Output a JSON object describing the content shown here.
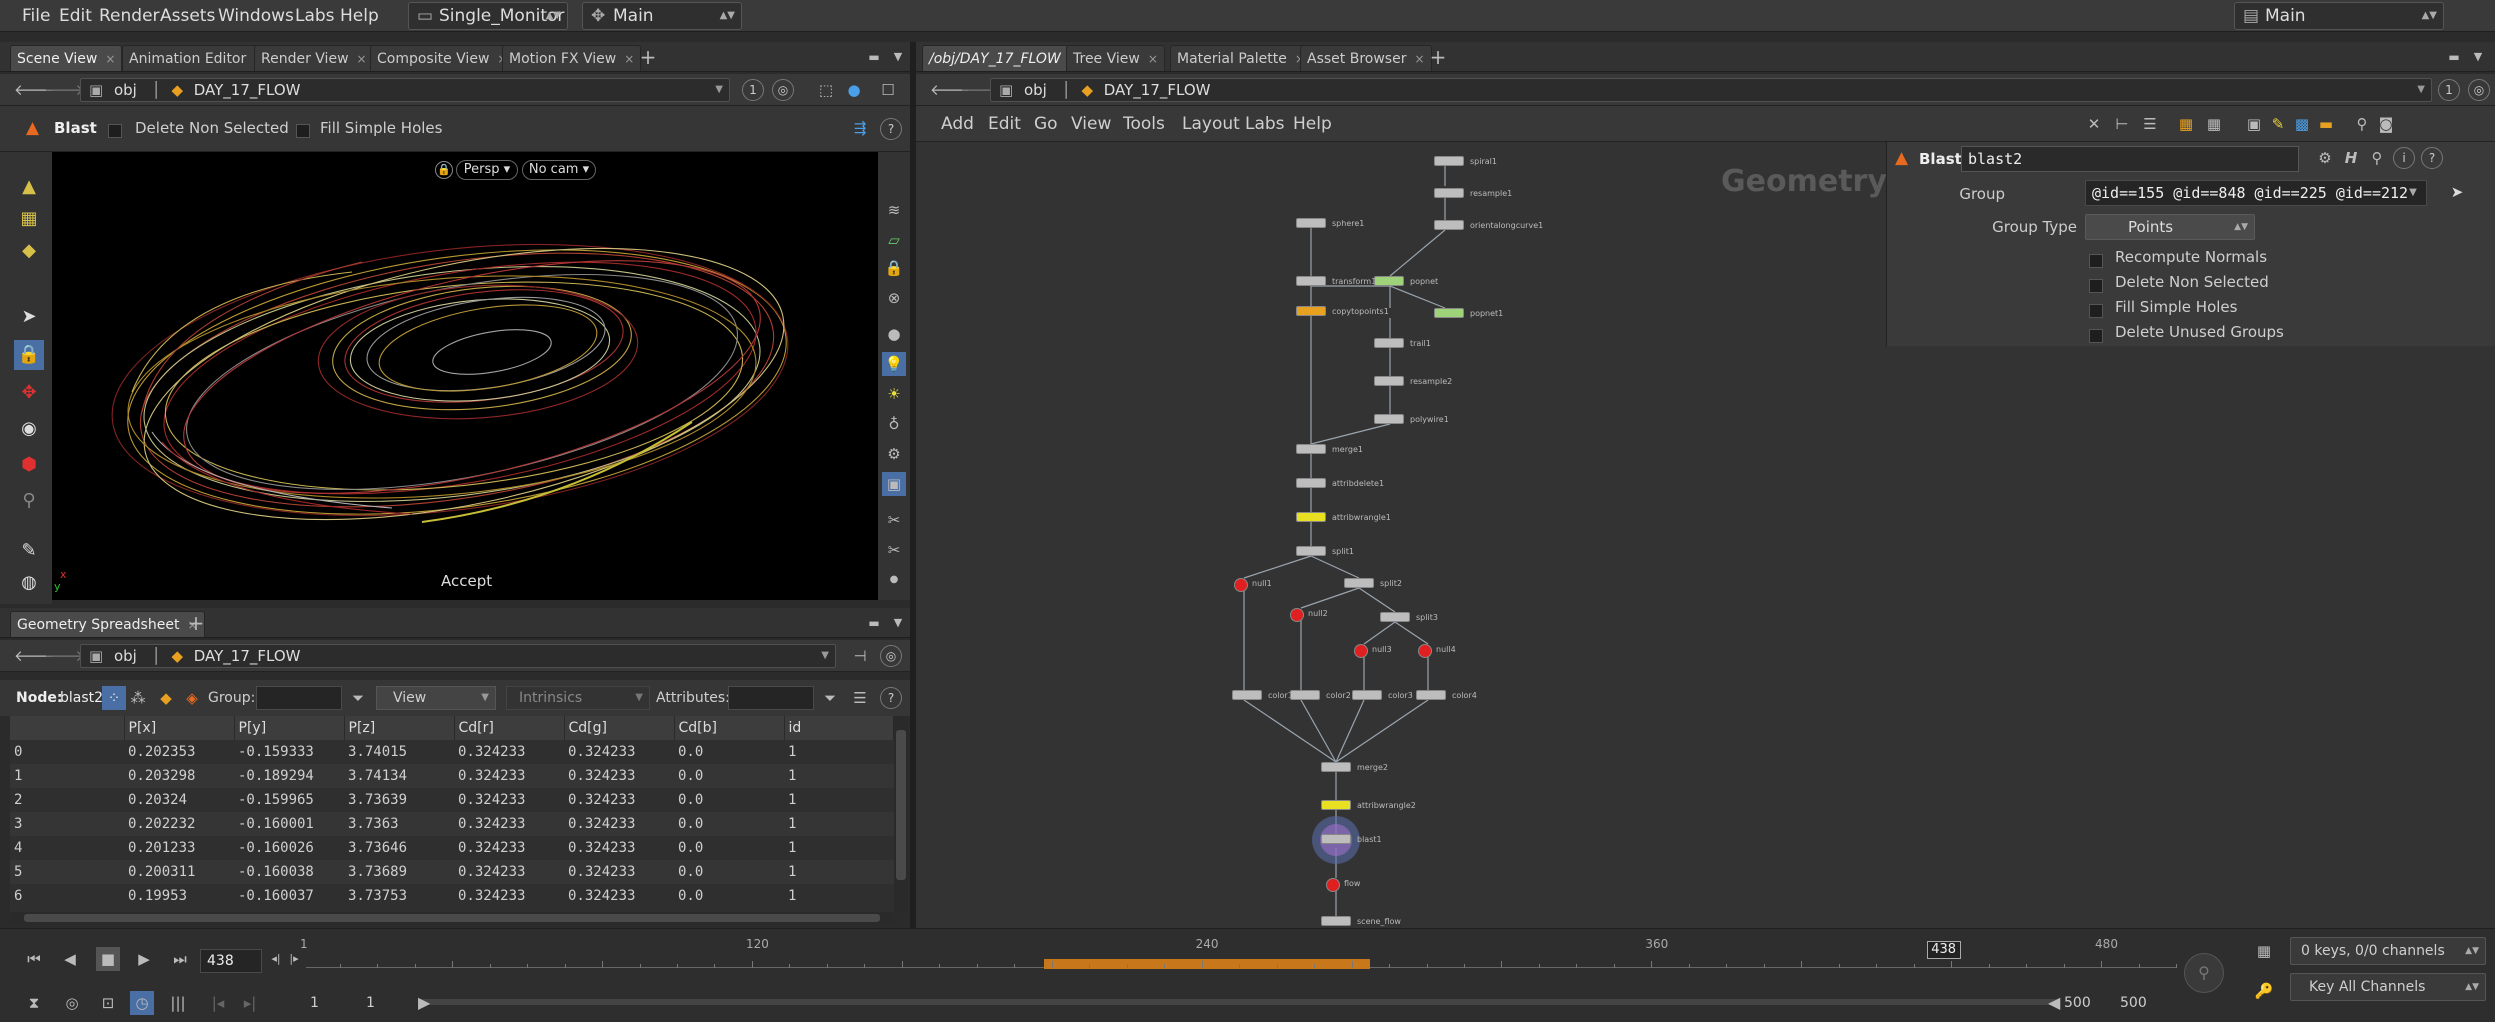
{
  "menubar": {
    "items": [
      "File",
      "Edit",
      "Render",
      "Assets",
      "Windows",
      "Labs",
      "Help"
    ],
    "desktop": "Single_Monitor",
    "context": "Main",
    "right_context": "Main"
  },
  "left_tabs": [
    "Scene View",
    "Animation Editor",
    "Render View",
    "Composite View",
    "Motion FX View"
  ],
  "scene": {
    "path_root": "obj",
    "path_node": "DAY_17_FLOW",
    "tool_name": "Blast",
    "opt_delete_non_selected": "Delete Non Selected",
    "opt_fill_simple_holes": "Fill Simple Holes",
    "persp": "Persp",
    "cam": "No cam",
    "accept": "Accept",
    "axis_x": "x",
    "axis_y": "y"
  },
  "spreadsheet": {
    "tab": "Geometry Spreadsheet",
    "path_root": "obj",
    "path_node": "DAY_17_FLOW",
    "node_label": "Node:",
    "node_name": "blast2",
    "group_label": "Group:",
    "view_label": "View",
    "intrinsics_label": "Intrinsics",
    "attributes_label": "Attributes:",
    "columns": [
      "",
      "P[x]",
      "P[y]",
      "P[z]",
      "Cd[r]",
      "Cd[g]",
      "Cd[b]",
      "id"
    ],
    "rows": [
      [
        "0",
        "0.202353",
        "-0.159333",
        "3.74015",
        "0.324233",
        "0.324233",
        "0.0",
        "1"
      ],
      [
        "1",
        "0.203298",
        "-0.189294",
        "3.74134",
        "0.324233",
        "0.324233",
        "0.0",
        "1"
      ],
      [
        "2",
        "0.20324",
        "-0.159965",
        "3.73639",
        "0.324233",
        "0.324233",
        "0.0",
        "1"
      ],
      [
        "3",
        "0.202232",
        "-0.160001",
        "3.7363",
        "0.324233",
        "0.324233",
        "0.0",
        "1"
      ],
      [
        "4",
        "0.201233",
        "-0.160026",
        "3.73646",
        "0.324233",
        "0.324233",
        "0.0",
        "1"
      ],
      [
        "5",
        "0.200311",
        "-0.160038",
        "3.73689",
        "0.324233",
        "0.324233",
        "0.0",
        "1"
      ],
      [
        "6",
        "0.19953",
        "-0.160037",
        "3.73753",
        "0.324233",
        "0.324233",
        "0.0",
        "1"
      ]
    ]
  },
  "right_tabs": [
    "/obj/DAY_17_FLOW",
    "Tree View",
    "Material Palette",
    "Asset Browser"
  ],
  "network": {
    "path_root": "obj",
    "path_node": "DAY_17_FLOW",
    "menu": [
      "Add",
      "Edit",
      "Go",
      "View",
      "Tools",
      "Layout",
      "Labs",
      "Help"
    ],
    "context_label": "Geometry",
    "nodes": [
      {
        "label": "spiral1",
        "color": "#bdbdbd"
      },
      {
        "label": "resample1",
        "color": "#bdbdbd"
      },
      {
        "label": "sphere1",
        "color": "#bdbdbd"
      },
      {
        "label": "orientalongcurve1",
        "color": "#bdbdbd"
      },
      {
        "label": "transform1",
        "color": "#bdbdbd"
      },
      {
        "label": "popnet",
        "color": "#9fd37a"
      },
      {
        "label": "copytopoints1",
        "color": "#e8a020"
      },
      {
        "label": "popnet1",
        "color": "#9fd37a"
      },
      {
        "label": "trail1",
        "color": "#bdbdbd"
      },
      {
        "label": "resample2",
        "color": "#bdbdbd"
      },
      {
        "label": "polywire1",
        "color": "#bdbdbd"
      },
      {
        "label": "merge1",
        "color": "#bdbdbd"
      },
      {
        "label": "attribdelete1",
        "color": "#bdbdbd"
      },
      {
        "label": "attribwrangle1",
        "color": "#e8e020"
      },
      {
        "label": "split1",
        "color": "#bdbdbd"
      },
      {
        "label": "null1",
        "color": "#e02020"
      },
      {
        "label": "split2",
        "color": "#bdbdbd"
      },
      {
        "label": "null2",
        "color": "#e02020"
      },
      {
        "label": "split3",
        "color": "#bdbdbd"
      },
      {
        "label": "null3",
        "color": "#e02020"
      },
      {
        "label": "null4",
        "color": "#e02020"
      },
      {
        "label": "color1",
        "color": "#bdbdbd"
      },
      {
        "label": "color2",
        "color": "#bdbdbd"
      },
      {
        "label": "color3",
        "color": "#bdbdbd"
      },
      {
        "label": "color4",
        "color": "#bdbdbd"
      },
      {
        "label": "merge2",
        "color": "#bdbdbd"
      },
      {
        "label": "attribwrangle2",
        "color": "#e8e020"
      },
      {
        "label": "blast1",
        "color": "#bdbdbd"
      },
      {
        "label": "flow",
        "color": "#e02020"
      },
      {
        "label": "scene_flow",
        "color": "#bdbdbd"
      }
    ]
  },
  "params": {
    "node_type": "Blast",
    "node_name": "blast2",
    "group_label": "Group",
    "group_value": "@id==155 @id==848 @id==225 @id==212",
    "group_type_label": "Group Type",
    "group_type_value": "Points",
    "checkboxes": [
      "Recompute Normals",
      "Delete Non Selected",
      "Fill Simple Holes",
      "Delete Unused Groups"
    ]
  },
  "timeline": {
    "current_frame": "438",
    "start": "1",
    "start2": "1",
    "end": "500",
    "end2": "500",
    "ticks": [
      "1",
      "120",
      "240",
      "360",
      "480"
    ],
    "marker": "438",
    "keys_label": "0 keys, 0/0 channels",
    "key_all": "Key All Channels"
  }
}
